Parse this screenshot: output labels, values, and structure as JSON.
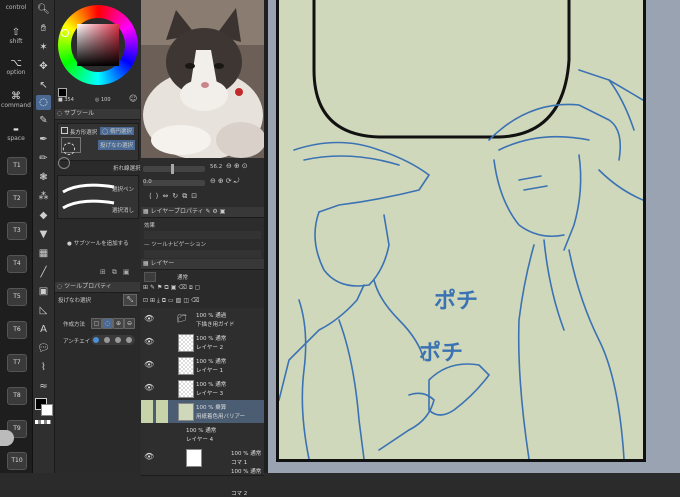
{
  "modifiers": {
    "control": "control",
    "shift": "shift",
    "option": "option",
    "command": "command",
    "space": "space",
    "t_keys": [
      "T1",
      "T2",
      "T3",
      "T4",
      "T5",
      "T6",
      "T7",
      "T8",
      "T9",
      "T10"
    ]
  },
  "color_panel": {
    "opacity_value": "100",
    "size_value": "354",
    "accent": "#4a6a93"
  },
  "subtool_panel": {
    "title": "サブツール",
    "tab_a": "投げなわ選択",
    "items": [
      "長方形選択",
      "楕円選択",
      "投げなわ選択",
      "折れ線選択",
      "選択ペン",
      "選択消し"
    ],
    "add_label": "サブツールを追加する"
  },
  "toolprop_panel": {
    "title": "ツールプロパティ",
    "subtitle": "投げなわ選択",
    "row1_label": "作成方法",
    "row2_label": "アンチエイ"
  },
  "nav_panel": {
    "zoom_value": "56.2",
    "angle_value": "0.0",
    "tab_layer_property": "レイヤープロパティ",
    "tab_effect": "効果",
    "tab_tool_nav": "ツールナビゲーション",
    "tab_layer": "レイヤー"
  },
  "layer_panel": {
    "blend_mode": "通常",
    "layers": [
      {
        "pct": "100 % 通過",
        "name": "下描き用ガイド"
      },
      {
        "pct": "100 % 通常",
        "name": "レイヤー 2"
      },
      {
        "pct": "100 % 通常",
        "name": "レイヤー 1"
      },
      {
        "pct": "100 % 通常",
        "name": "レイヤー 3"
      },
      {
        "pct": "100 % 乗算",
        "name": "用紙着色用バリアー"
      },
      {
        "pct": "100 % 通常",
        "name": "レイヤー 4"
      },
      {
        "pct": "100 % 通常",
        "name": "コマ 1"
      },
      {
        "pct": "100 % 通常",
        "name": "コマ 2"
      }
    ]
  },
  "canvas": {
    "paper_color": "#d0d8bb",
    "line_color": "#3b72b3",
    "sfx_text": "ポチ ポチ"
  }
}
